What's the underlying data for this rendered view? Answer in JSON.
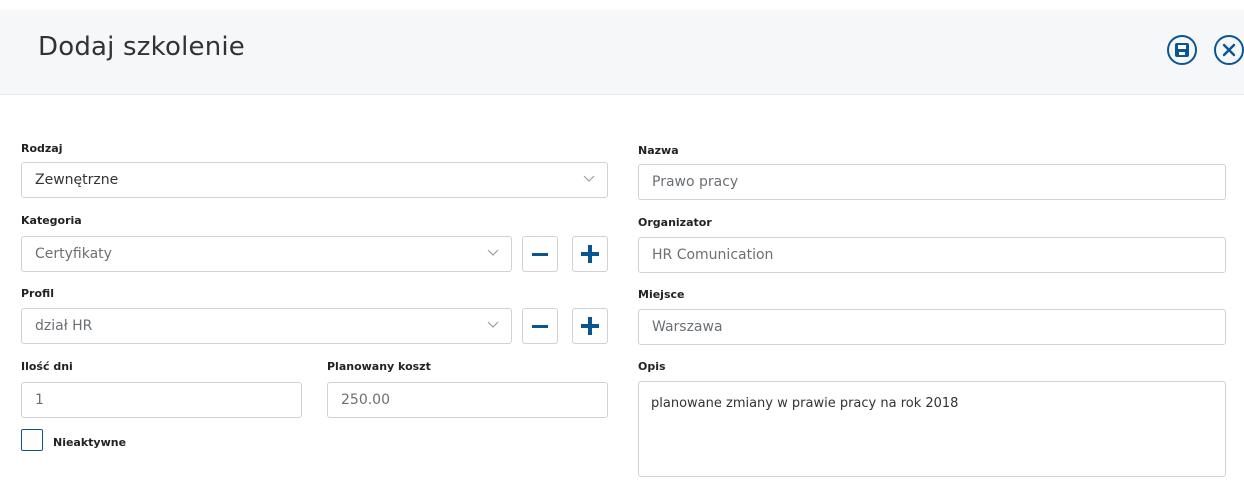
{
  "header": {
    "title": "Dodaj szkolenie",
    "save_icon": "floppy-disk-icon",
    "close_icon": "close-icon",
    "accent_color": "#0c5593"
  },
  "form": {
    "rodzaj": {
      "label": "Rodzaj",
      "value": "Zewnętrzne"
    },
    "kategoria": {
      "label": "Kategoria",
      "value": "Certyfikaty"
    },
    "profil": {
      "label": "Profil",
      "value": "dział HR"
    },
    "ilosc_dni": {
      "label": "Ilość dni",
      "value": "1"
    },
    "planowany_koszt": {
      "label": "Planowany koszt",
      "value": "250.00"
    },
    "nieaktywne": {
      "label": "Nieaktywne",
      "checked": false
    },
    "nazwa": {
      "label": "Nazwa",
      "value": "Prawo pracy"
    },
    "organizator": {
      "label": "Organizator",
      "value": "HR Comunication"
    },
    "miejsce": {
      "label": "Miejsce",
      "value": "Warszawa"
    },
    "opis": {
      "label": "Opis",
      "value": "planowane zmiany w prawie pracy na rok 2018"
    }
  },
  "icons": {
    "dropdown": "chevron-down-icon",
    "remove": "minus-icon",
    "add": "plus-icon"
  }
}
